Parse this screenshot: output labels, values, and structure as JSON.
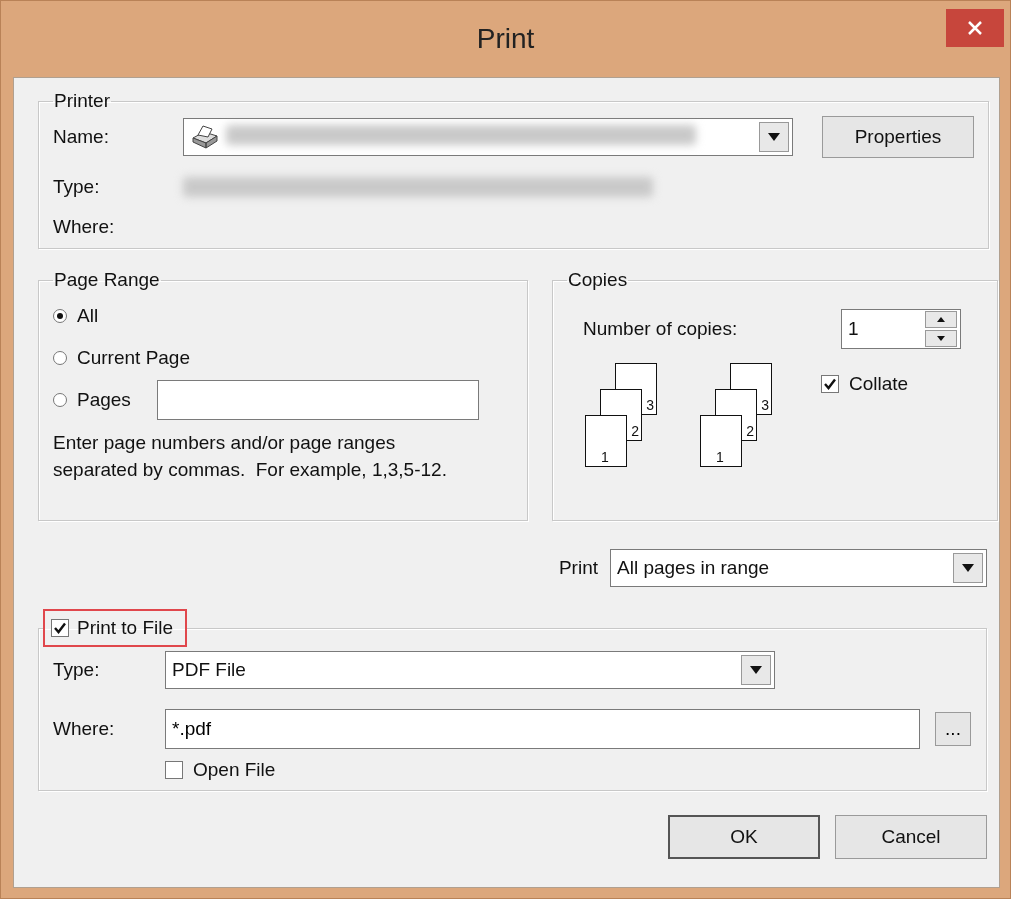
{
  "window": {
    "title": "Print"
  },
  "printer": {
    "legend": "Printer",
    "name_label": "Name:",
    "type_label": "Type:",
    "where_label": "Where:",
    "properties_button": "Properties"
  },
  "page_range": {
    "legend": "Page Range",
    "options": [
      {
        "label": "All",
        "selected": true
      },
      {
        "label": "Current Page",
        "selected": false
      },
      {
        "label": "Pages",
        "selected": false
      }
    ],
    "hint": "Enter page numbers and/or page ranges separated by commas.  For example, 1,3,5-12."
  },
  "copies": {
    "legend": "Copies",
    "label": "Number of copies:",
    "value": "1",
    "collate": {
      "label": "Collate",
      "checked": true
    },
    "stacks": [
      {
        "pages": [
          "1",
          "2",
          "3"
        ]
      },
      {
        "pages": [
          "1",
          "2",
          "3"
        ]
      }
    ]
  },
  "print_what": {
    "label": "Print",
    "value": "All pages in range"
  },
  "print_to_file": {
    "label": "Print to File",
    "checked": true,
    "highlighted": true,
    "type_label": "Type:",
    "type_value": "PDF File",
    "where_label": "Where:",
    "where_value": "*.pdf",
    "browse_button": "...",
    "open_file": {
      "label": "Open File",
      "checked": false
    }
  },
  "buttons": [
    {
      "label": "OK",
      "default": true
    },
    {
      "label": "Cancel",
      "default": false
    }
  ]
}
